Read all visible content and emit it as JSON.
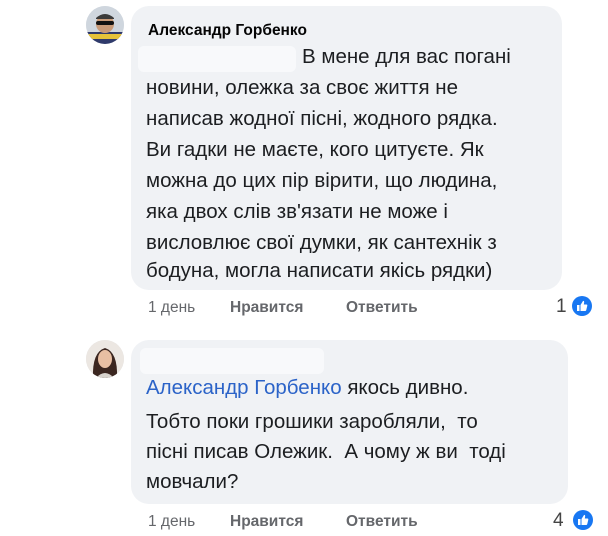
{
  "comments": [
    {
      "author": "Александр Горбенко",
      "lines": [
        "В мене для вас погані",
        "новини, олежка за своє життя не",
        "написав жодної пісні, жодного рядка.",
        "Ви гадки не маєте, кого цитуєте. Як",
        "можна до цих пір вірити, що людина,",
        "яка двох слів зв'язати не може і",
        "висловлює свої думки, як сантехнік з",
        "бодуна, могла написати якісь рядки)"
      ],
      "time": "1 день",
      "like_label": "Нравится",
      "reply_label": "Ответить",
      "reaction_count": "1",
      "reaction_icon": "like-icon"
    },
    {
      "mention": "Александр Горбенко",
      "lines": [
        " якось дивно.",
        "Тобто поки грошики заробляли,  то",
        "пісні писав Олежик.  А чому ж ви  тоді",
        "мовчали?"
      ],
      "time": "1 день",
      "like_label": "Нравится",
      "reply_label": "Ответить",
      "reaction_count": "4",
      "reaction_icon": "like-icon"
    }
  ],
  "colors": {
    "bubble": "#f0f2f5",
    "mention": "#2b63c8",
    "meta": "#65676b",
    "like": "#1877f2"
  }
}
